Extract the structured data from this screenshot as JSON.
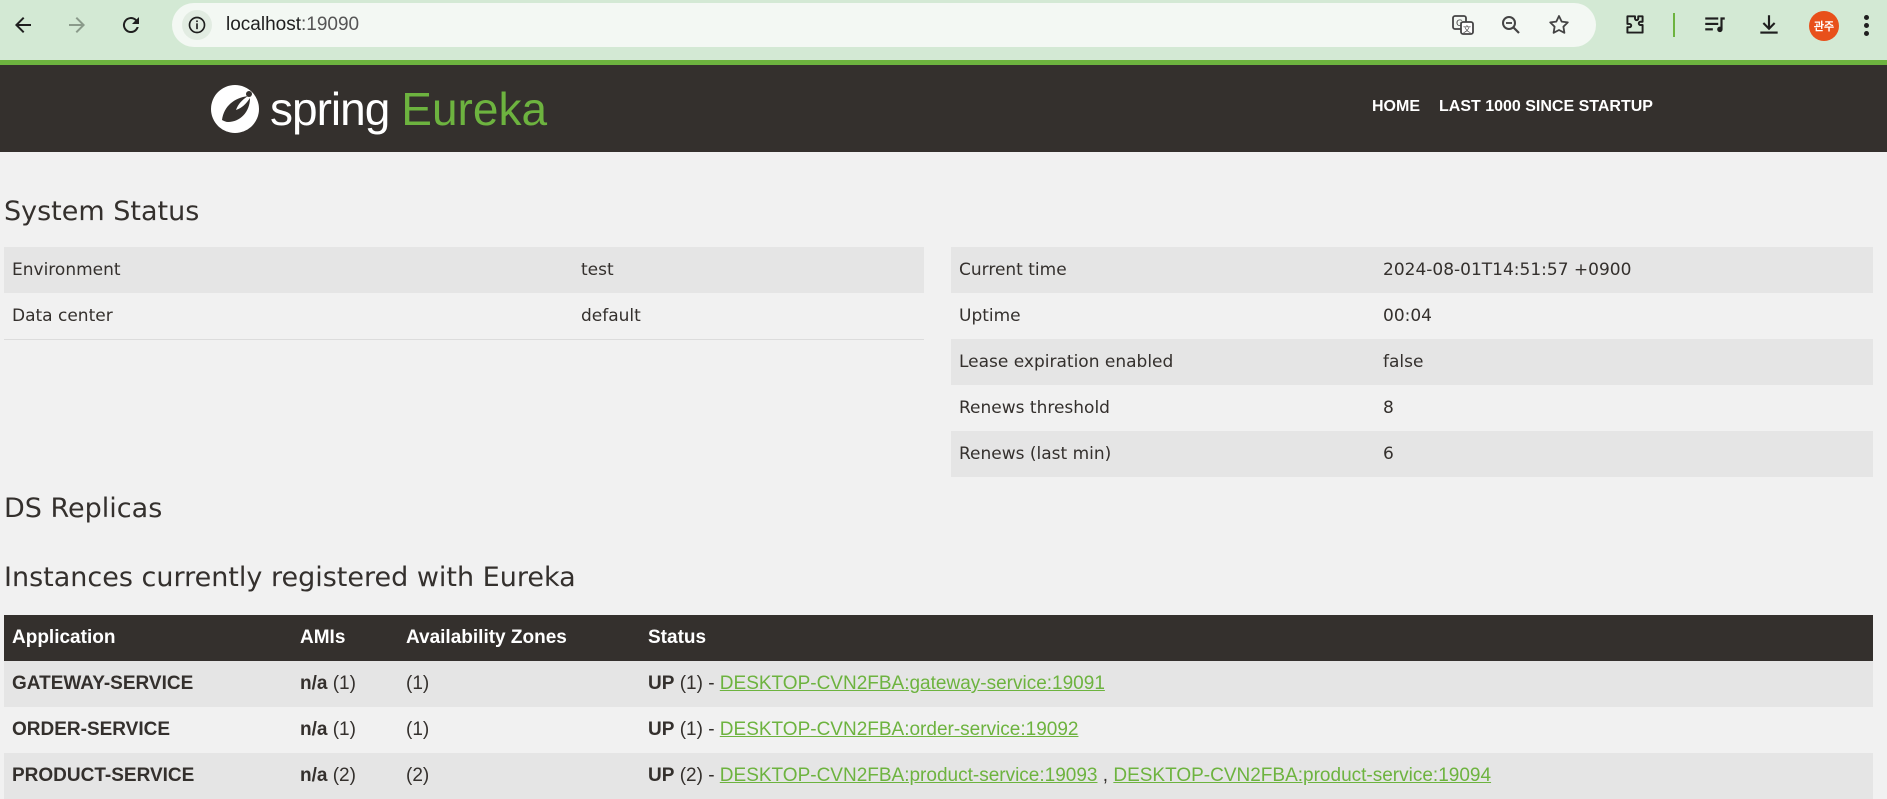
{
  "browser": {
    "url_host": "localhost",
    "url_port": ":19090",
    "profile_initials": "관주"
  },
  "navbar": {
    "logo_spring": "spring",
    "logo_eureka": "Eureka",
    "links": [
      "HOME",
      "LAST 1000 SINCE STARTUP"
    ]
  },
  "system_status": {
    "title": "System Status",
    "left": [
      {
        "label": "Environment",
        "value": "test"
      },
      {
        "label": "Data center",
        "value": "default"
      }
    ],
    "right": [
      {
        "label": "Current time",
        "value": "2024-08-01T14:51:57 +0900"
      },
      {
        "label": "Uptime",
        "value": "00:04"
      },
      {
        "label": "Lease expiration enabled",
        "value": "false"
      },
      {
        "label": "Renews threshold",
        "value": "8"
      },
      {
        "label": "Renews (last min)",
        "value": "6"
      }
    ]
  },
  "ds_replicas": {
    "title": "DS Replicas"
  },
  "instances": {
    "title": "Instances currently registered with Eureka",
    "headers": [
      "Application",
      "AMIs",
      "Availability Zones",
      "Status"
    ],
    "rows": [
      {
        "application": "GATEWAY-SERVICE",
        "amis_label": "n/a",
        "amis_count": "(1)",
        "zones": "(1)",
        "status": "UP",
        "status_count": "(1) -",
        "links": [
          "DESKTOP-CVN2FBA:gateway-service:19091"
        ]
      },
      {
        "application": "ORDER-SERVICE",
        "amis_label": "n/a",
        "amis_count": "(1)",
        "zones": "(1)",
        "status": "UP",
        "status_count": "(1) -",
        "links": [
          "DESKTOP-CVN2FBA:order-service:19092"
        ]
      },
      {
        "application": "PRODUCT-SERVICE",
        "amis_label": "n/a",
        "amis_count": "(2)",
        "zones": "(2)",
        "status": "UP",
        "status_count": "(2) -",
        "links": [
          "DESKTOP-CVN2FBA:product-service:19093",
          "DESKTOP-CVN2FBA:product-service:19094"
        ],
        "link_separator": ","
      }
    ]
  }
}
